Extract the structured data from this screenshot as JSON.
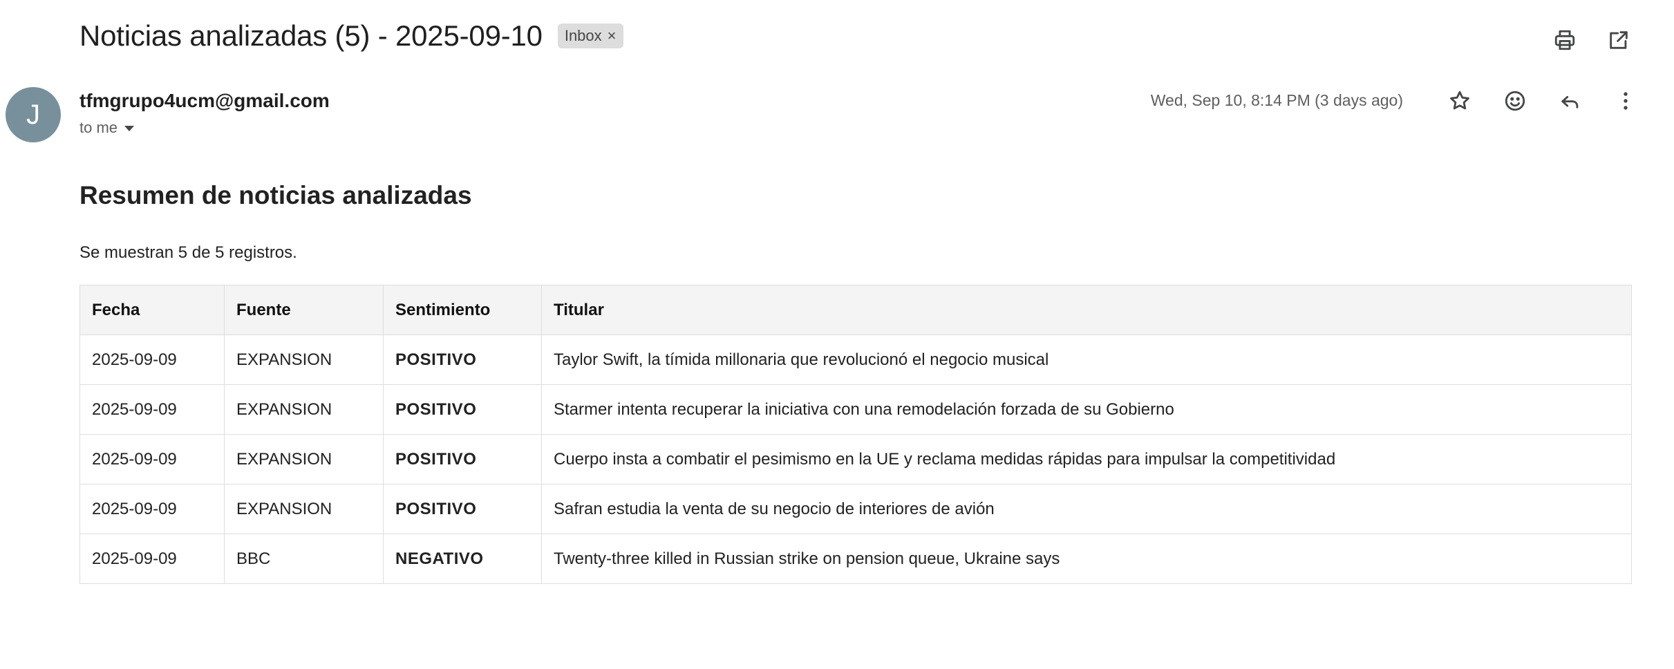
{
  "email": {
    "subject": "Noticias analizadas (5) - 2025-09-10",
    "label": "Inbox",
    "label_remove": "×",
    "sender_initial": "J",
    "sender": "tfmgrupo4ucm@gmail.com",
    "recipient": "to me",
    "date": "Wed, Sep 10, 8:14 PM (3 days ago)"
  },
  "icons": {
    "print": "print-icon",
    "open_new_window": "open-in-new-window-icon",
    "star": "star-icon",
    "emoji": "emoji-reaction-icon",
    "reply": "reply-icon",
    "more": "more-vertical-icon"
  },
  "body": {
    "heading": "Resumen de noticias analizadas",
    "count_text": "Se muestran 5 de 5 registros.",
    "table": {
      "headers": [
        "Fecha",
        "Fuente",
        "Sentimiento",
        "Titular"
      ],
      "rows": [
        {
          "fecha": "2025-09-09",
          "fuente": "EXPANSION",
          "sentimiento": "POSITIVO",
          "titular": "Taylor Swift, la tímida millonaria que revolucionó el negocio musical"
        },
        {
          "fecha": "2025-09-09",
          "fuente": "EXPANSION",
          "sentimiento": "POSITIVO",
          "titular": "Starmer intenta recuperar la iniciativa con una remodelación forzada de su Gobierno"
        },
        {
          "fecha": "2025-09-09",
          "fuente": "EXPANSION",
          "sentimiento": "POSITIVO",
          "titular": "Cuerpo insta a combatir el pesimismo en la UE y reclama medidas rápidas para impulsar la competitividad"
        },
        {
          "fecha": "2025-09-09",
          "fuente": "EXPANSION",
          "sentimiento": "POSITIVO",
          "titular": "Safran estudia la venta de su negocio de interiores de avión"
        },
        {
          "fecha": "2025-09-09",
          "fuente": "BBC",
          "sentimiento": "NEGATIVO",
          "titular": "Twenty-three killed in Russian strike on pension queue, Ukraine says"
        }
      ]
    }
  },
  "colors": {
    "positive": "#2e7d5b",
    "negative": "#a31f3a",
    "avatar": "#78909c"
  }
}
